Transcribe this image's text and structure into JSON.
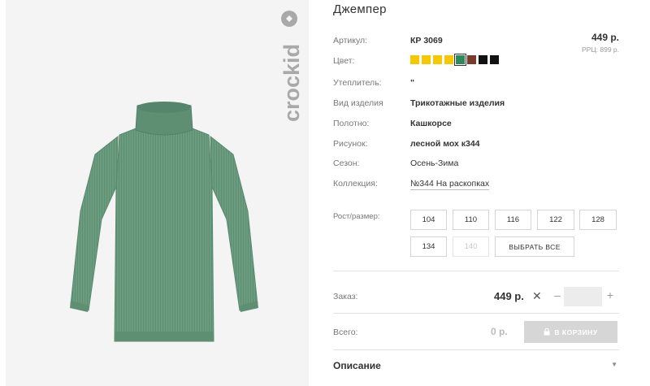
{
  "product": {
    "title": "Джемпер",
    "price": "449 р.",
    "rrc_price": "РРЦ: 899 р."
  },
  "brand": {
    "logo_text": "crockid"
  },
  "specs": [
    {
      "label": "Артикул:",
      "value": "КР 3069"
    },
    {
      "label": "Цвет:",
      "value": ""
    },
    {
      "label": "Утеплитель:",
      "value": "\""
    },
    {
      "label": "Вид изделия",
      "value": "Трикотажные изделия"
    },
    {
      "label": "Полотно:",
      "value": "Кашкорсе"
    },
    {
      "label": "Рисунок:",
      "value": "лесной мох к344"
    },
    {
      "label": "Сезон:",
      "value": "Осень-Зима"
    },
    {
      "label": "Коллекция:",
      "value": "№344 На раскопках"
    }
  ],
  "colors": {
    "swatches": [
      "#f5c800",
      "#f5c800",
      "#f5c800",
      "#f5c800",
      "#2e8a5a",
      "#7a3b2a",
      "#111111",
      "#111111"
    ],
    "selected_index": 4,
    "garment": "#6b9c80",
    "accent_disabled": "#d6d6d6"
  },
  "sizes": {
    "label": "Рост/размер:",
    "options": [
      {
        "label": "104",
        "enabled": true
      },
      {
        "label": "110",
        "enabled": true
      },
      {
        "label": "116",
        "enabled": true
      },
      {
        "label": "122",
        "enabled": true
      },
      {
        "label": "128",
        "enabled": true
      },
      {
        "label": "134",
        "enabled": true
      },
      {
        "label": "140",
        "enabled": false
      }
    ],
    "select_all_label": "ВЫБРАТЬ ВСЕ"
  },
  "order": {
    "label": "Заказ:",
    "price": "449 р.",
    "clear_symbol": "✕",
    "minus_symbol": "–",
    "plus_symbol": "+",
    "quantity": ""
  },
  "total": {
    "label": "Всего:",
    "value": "0 р.",
    "cart_button_label": "В КОРЗИНУ",
    "cart_icon": "lock-icon"
  },
  "description": {
    "label": "Описание",
    "chevron": "▼"
  }
}
